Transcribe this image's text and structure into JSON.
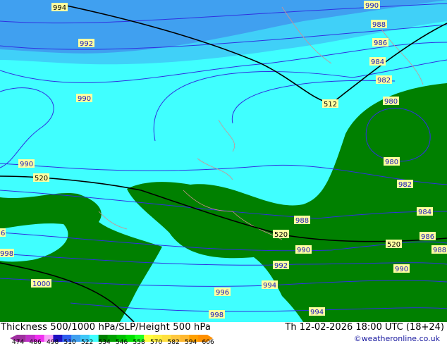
{
  "map": {
    "colors": {
      "sea_light": "#40ffff",
      "band_mid": "#40d0f8",
      "band_blue": "#40a0f0",
      "land_green": "#008000",
      "contour": "#3030e0",
      "border": "#d09090",
      "thickness_line": "#000000",
      "label_bg": "#ffffa0"
    },
    "thickness_labels": [
      "994",
      "512",
      "520",
      "520",
      "520"
    ],
    "pressure_labels": [
      "990",
      "988",
      "986",
      "984",
      "982",
      "980",
      "980",
      "982",
      "984",
      "986",
      "988",
      "990",
      "992",
      "990",
      "990",
      "988",
      "990",
      "992",
      "994",
      "996",
      "998",
      "1000",
      "998",
      "6",
      "994"
    ]
  },
  "footer": {
    "title": "Thickness 500/1000 hPa/SLP/Height 500 hPa",
    "time": "Th 12-02-2026 18:00 UTC (18+24)",
    "credit": "©weatheronline.co.uk",
    "legend_ticks": [
      "474",
      "486",
      "498",
      "510",
      "522",
      "534",
      "546",
      "558",
      "570",
      "582",
      "594",
      "606"
    ],
    "legend_colors": [
      "#a030a0",
      "#c030c8",
      "#f030f0",
      "#f8a0f8",
      "#2010c0",
      "#3060f0",
      "#40a0f0",
      "#40c8f8",
      "#40ffff",
      "#008000",
      "#00a000",
      "#00c000",
      "#00e000",
      "#20ff20",
      "#ffff40",
      "#fff040",
      "#ffe040",
      "#ffc840",
      "#ffb830",
      "#ffa000",
      "#ff9000"
    ]
  }
}
